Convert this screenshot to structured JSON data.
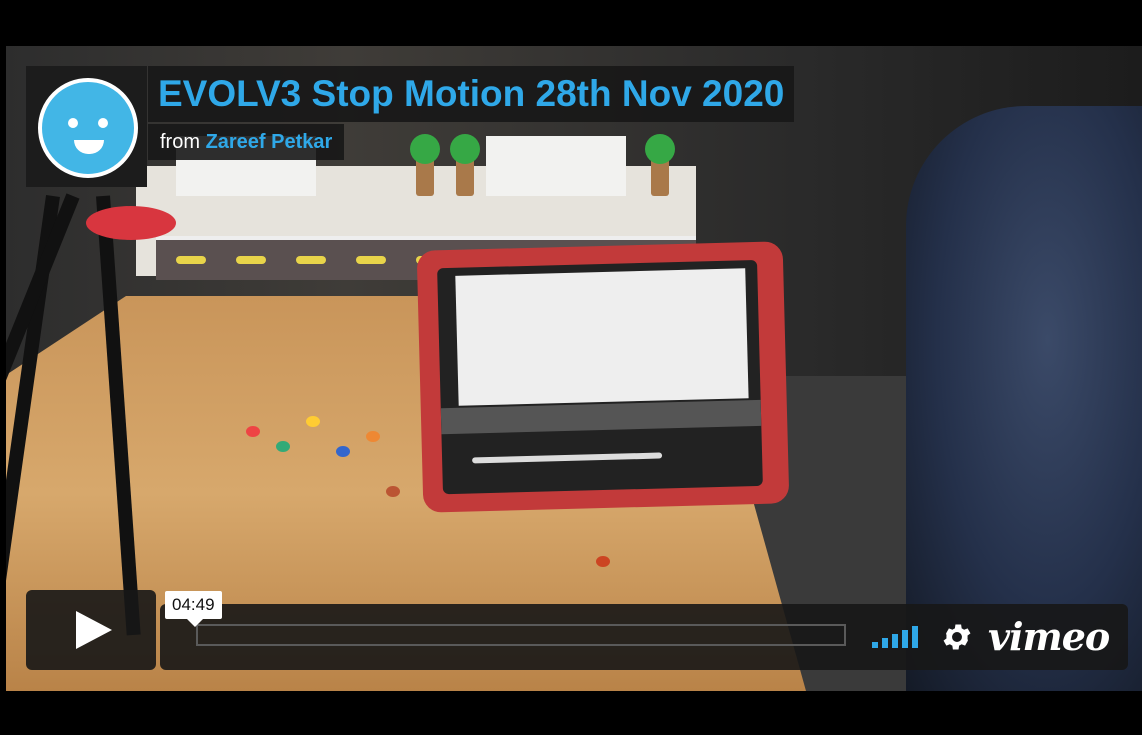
{
  "player": {
    "title": "EVOLV3 Stop Motion 28th Nov 2020",
    "byline_prefix": "from",
    "author": "Zareef Petkar",
    "time_tooltip": "04:49",
    "progress_fraction": 0.0,
    "brand": "vimeo",
    "accent_color": "#2fa8e8"
  },
  "icons": {
    "play": "play-icon",
    "volume": "volume-bars-icon",
    "settings": "gear-icon",
    "avatar": "smiley-avatar-icon"
  }
}
